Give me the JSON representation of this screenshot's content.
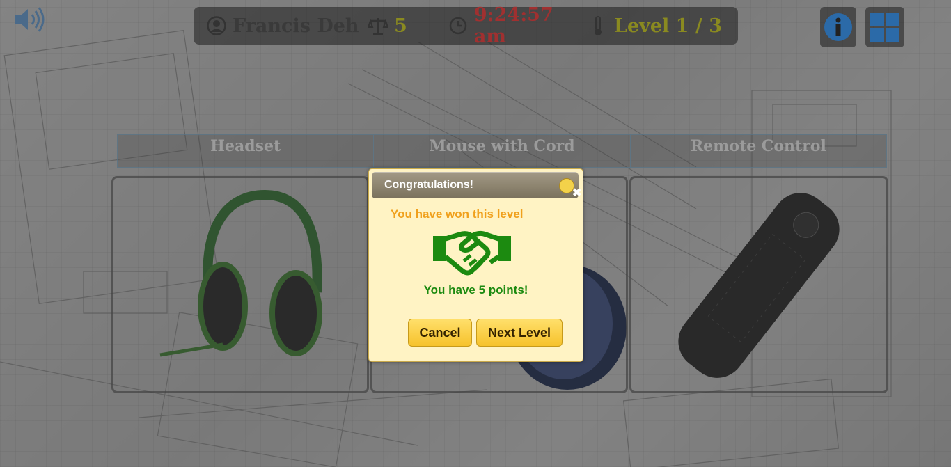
{
  "hud": {
    "player_name": "Francis Deh",
    "score": "5",
    "time": "9:24:57 am",
    "level": "Level 1 / 3"
  },
  "icons": {
    "sound": "volume-icon",
    "player": "user-circle-icon",
    "score": "balance-scale-icon",
    "clock": "clock-icon",
    "level": "thermometer-icon",
    "info": "info-icon",
    "windows": "windows-icon"
  },
  "categories": [
    "Headset",
    "Mouse with Cord",
    "Remote Control"
  ],
  "dialog": {
    "title": "Congratulations!",
    "message": "You have won this level",
    "points_message": "You have 5 points!",
    "cancel_label": "Cancel",
    "next_label": "Next Level"
  },
  "colors": {
    "dialog_bg": "#fff3c4",
    "accent_orange": "#f0a01c",
    "success_green": "#1c8a10",
    "button_yellow": "#f6c22c"
  }
}
